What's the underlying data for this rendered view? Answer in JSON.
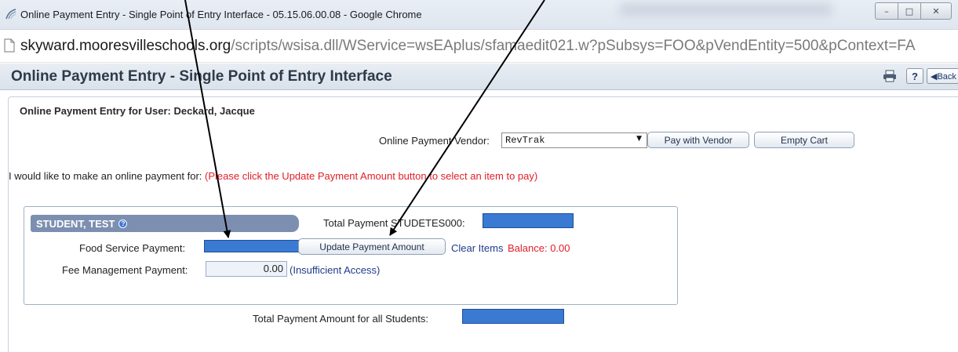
{
  "window": {
    "title": "Online Payment Entry - Single Point of Entry Interface - 05.15.06.00.08 - Google Chrome",
    "controls": {
      "minimize": "–",
      "maximize": "□",
      "close": "✕"
    }
  },
  "address_bar": {
    "host": "skyward.mooresvilleschools.org",
    "path": "/scripts/wsisa.dll/WService=wsEAplus/sfamaedit021.w?pSubsys=FOO&pVendEntity=500&pContext=FA"
  },
  "header": {
    "title": "Online Payment Entry - Single Point of Entry Interface",
    "help_label": "?",
    "back_label": "◀Back"
  },
  "page": {
    "user_label": "Online Payment Entry for User: Deckard, Jacque",
    "vendor_label": "Online Payment Vendor:",
    "vendor_value": "RevTrak",
    "pay_with_vendor": "Pay with Vendor",
    "empty_cart": "Empty Cart",
    "instruction_prefix": "I would like to make an online payment for:",
    "instruction_warning": "(Please click the Update Payment Amount button to select an item to pay)"
  },
  "student": {
    "name": "STUDENT, TEST",
    "info_icon": "info-icon",
    "total_payment_label": "Total Payment STUDETES000:",
    "food_label": "Food Service Payment:",
    "fee_label": "Fee Management Payment:",
    "fee_value": "0.00",
    "update_button": "Update Payment Amount",
    "clear_items": "Clear Items",
    "balance": "Balance: 0.00",
    "insufficient": "(Insufficient Access)"
  },
  "footer": {
    "grand_total_label": "Total Payment Amount for all Students:"
  },
  "colors": {
    "student_tab": "#7d8fb0",
    "warning_red": "#e0202a",
    "link_blue": "#1d3b8a",
    "redaction_blue": "#3a7ad3"
  }
}
